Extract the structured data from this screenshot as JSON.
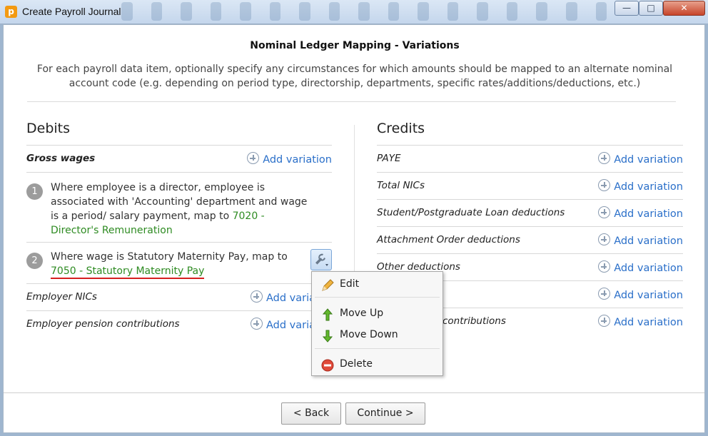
{
  "window": {
    "title": "Create Payroll Journal",
    "app_icon": "p",
    "minimize_glyph": "—",
    "maximize_glyph": "□",
    "close_glyph": "✕"
  },
  "heading": "Nominal Ledger Mapping - Variations",
  "description": "For each payroll data item, optionally specify any circumstances for which amounts should be mapped to an alternate nominal account code (e.g. depending on period type, directorship, departments, specific rates/additions/deductions, etc.)",
  "add_variation_label": "Add variation",
  "debits": {
    "title": "Debits",
    "items": [
      {
        "label": "Gross wages",
        "add_label": "Add variation"
      },
      {
        "label": "Employer NICs",
        "add_label": "Add varia"
      },
      {
        "label": "Employer pension contributions",
        "add_label": "Add varia"
      }
    ],
    "variations": [
      {
        "number": "1",
        "text": "Where employee is a director, employee is associated with 'Accounting' department and wage is a period/ salary payment, map to ",
        "code": "7020 - Director's Remuneration"
      },
      {
        "number": "2",
        "text": "Where wage is Statutory Maternity Pay, map to",
        "code": "7050 - Statutory Maternity Pay"
      }
    ]
  },
  "credits": {
    "title": "Credits",
    "items": [
      {
        "label": "PAYE",
        "add_label": "Add variation"
      },
      {
        "label": "Total NICs",
        "add_label": "Add variation"
      },
      {
        "label": "Student/Postgraduate Loan deductions",
        "add_label": "Add variation"
      },
      {
        "label": "Attachment Order deductions",
        "add_label": "Add variation"
      },
      {
        "label": "Other deductions",
        "add_label": "Add variation"
      },
      {
        "label": "",
        "add_label": "Add variation"
      },
      {
        "label": "contributions",
        "add_label": "Add variation"
      }
    ]
  },
  "context_menu": {
    "edit": "Edit",
    "move_up": "Move Up",
    "move_down": "Move Down",
    "delete": "Delete"
  },
  "buttons": {
    "back": "< Back",
    "continue": "Continue >"
  },
  "colors": {
    "link": "#2a6fc9",
    "code_green": "#2e8b22",
    "underline_red": "#d61f1f"
  }
}
